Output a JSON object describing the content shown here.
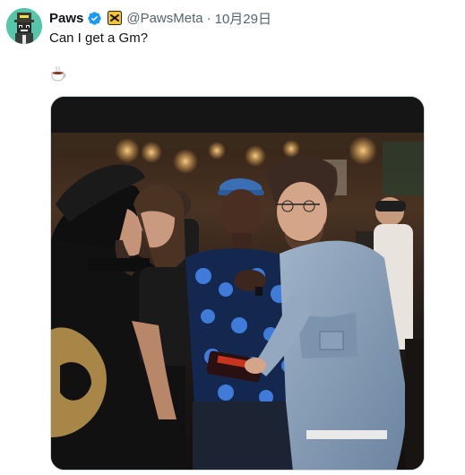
{
  "author": {
    "display_name": "Paws",
    "handle": "@PawsMeta",
    "separator": "·",
    "date": "10月29日",
    "avatar_icon": "pixel-character-avatar",
    "verified_icon": "verified-badge-icon",
    "affiliate_icon": "affiliate-badge-icon"
  },
  "tweet": {
    "text": "Can I get a Gm?",
    "emoji_icon": "coffee-cup-icon"
  },
  "media": {
    "icon": "event-photo"
  },
  "colors": {
    "verified": "#1d9bf0",
    "affiliate_bg": "#f7c325",
    "secondary_text": "#536471",
    "avatar_bg": "#55c6a9"
  }
}
